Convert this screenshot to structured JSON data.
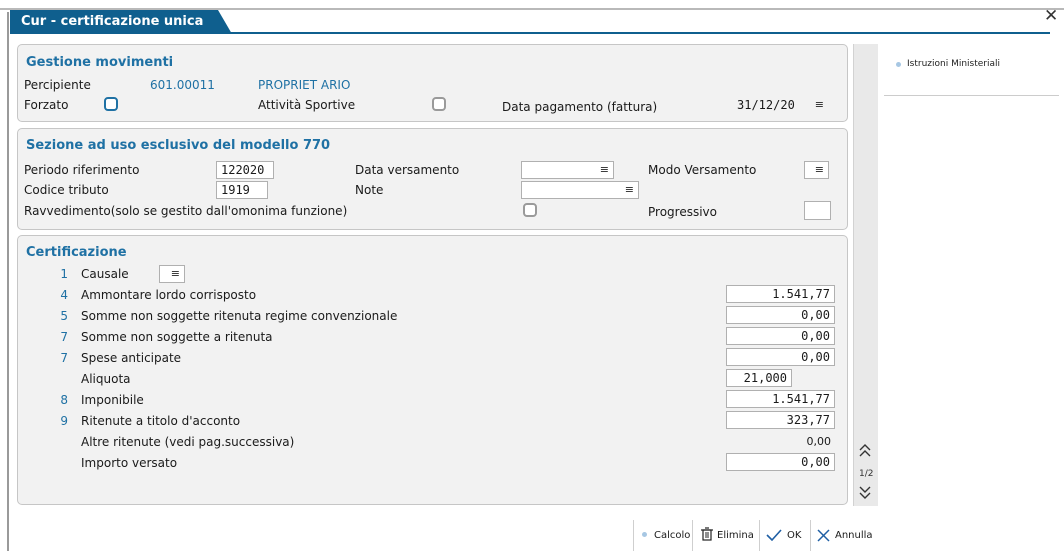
{
  "window": {
    "title": "Cur - certificazione unica",
    "close_label": "✕"
  },
  "section_movimenti": {
    "title": "Gestione movimenti",
    "percipiente_label": "Percipiente",
    "percipiente_code": "601.00011",
    "percipiente_name": "PROPRIET ARIO",
    "forzato_label": "Forzato",
    "attivita_label": "Attività Sportive",
    "data_pagamento_label": "Data pagamento (fattura)",
    "data_pagamento_value": "31/12/20"
  },
  "section_770": {
    "title": "Sezione ad uso esclusivo del modello 770",
    "periodo_label": "Periodo riferimento",
    "periodo_value": "122020",
    "data_versamento_label": "Data versamento",
    "data_versamento_value": "",
    "modo_versamento_label": "Modo Versamento",
    "codice_tributo_label": "Codice tributo",
    "codice_tributo_value": "1919",
    "note_label": "Note",
    "note_value": "",
    "ravvedimento_label": "Ravvedimento(solo se gestito dall'omonima funzione)",
    "progressivo_label": "Progressivo",
    "progressivo_value": ""
  },
  "section_certificazione": {
    "title": "Certificazione",
    "causale_num": "1",
    "causale_label": "Causale",
    "rows": [
      {
        "num": "4",
        "label": "Ammontare lordo corrisposto",
        "value": "1.541,77"
      },
      {
        "num": "5",
        "label": "Somme non soggette ritenuta regime convenzionale",
        "value": "0,00"
      },
      {
        "num": "7",
        "label": "Somme non soggette a ritenuta",
        "value": "0,00"
      },
      {
        "num": "7",
        "label": "Spese anticipate",
        "value": "0,00"
      },
      {
        "num": "",
        "label": "Aliquota",
        "value": "21,000"
      },
      {
        "num": "8",
        "label": "Imponibile",
        "value": "1.541,77"
      },
      {
        "num": "9",
        "label": "Ritenute a titolo d'acconto",
        "value": "323,77"
      },
      {
        "num": "",
        "label": "Altre ritenute (vedi pag.successiva)",
        "value": "0,00"
      },
      {
        "num": "",
        "label": "Importo versato",
        "value": "0,00"
      }
    ]
  },
  "pager": {
    "page_indicator": "1/2"
  },
  "side_panel": {
    "istruzioni_label": "Istruzioni Ministeriali"
  },
  "footer": {
    "calcolo_label": "Calcolo",
    "elimina_label": "Elimina",
    "ok_label": "OK",
    "annulla_label": "Annulla"
  },
  "colors": {
    "accent": "#0f5f8e",
    "section_title": "#1f71a4",
    "panel_bg": "#f2f2f2"
  },
  "icons": [
    "menu-icon",
    "checkbox-icon",
    "chevron-double-up-icon",
    "chevron-double-down-icon",
    "trash-icon",
    "check-icon",
    "close-icon",
    "dot-icon"
  ]
}
